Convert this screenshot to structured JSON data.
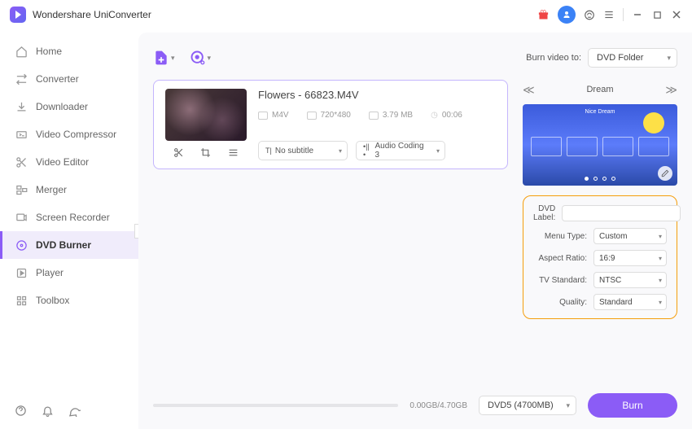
{
  "app": {
    "title": "Wondershare UniConverter"
  },
  "sidebar": {
    "items": [
      {
        "label": "Home",
        "icon": "home"
      },
      {
        "label": "Converter",
        "icon": "converter"
      },
      {
        "label": "Downloader",
        "icon": "downloader"
      },
      {
        "label": "Video Compressor",
        "icon": "compressor"
      },
      {
        "label": "Video Editor",
        "icon": "editor"
      },
      {
        "label": "Merger",
        "icon": "merger"
      },
      {
        "label": "Screen Recorder",
        "icon": "recorder"
      },
      {
        "label": "DVD Burner",
        "icon": "burner"
      },
      {
        "label": "Player",
        "icon": "player"
      },
      {
        "label": "Toolbox",
        "icon": "toolbox"
      }
    ]
  },
  "toolbar": {
    "burn_to_label": "Burn video to:",
    "burn_target": "DVD Folder"
  },
  "file": {
    "name": "Flowers - 66823.M4V",
    "format": "M4V",
    "resolution": "720*480",
    "size": "3.79 MB",
    "duration": "00:06",
    "subtitle": "No subtitle",
    "audio": "Audio Coding 3"
  },
  "template": {
    "name": "Dream",
    "preview_title": "Nice Dream"
  },
  "settings": {
    "labels": {
      "dvd_label": "DVD Label:",
      "menu_type": "Menu Type:",
      "aspect_ratio": "Aspect Ratio:",
      "tv_standard": "TV Standard:",
      "quality": "Quality:"
    },
    "values": {
      "dvd_label": "",
      "menu_type": "Custom",
      "aspect_ratio": "16:9",
      "tv_standard": "NTSC",
      "quality": "Standard"
    }
  },
  "bottom": {
    "size": "0.00GB/4.70GB",
    "disc": "DVD5 (4700MB)",
    "burn_label": "Burn"
  }
}
